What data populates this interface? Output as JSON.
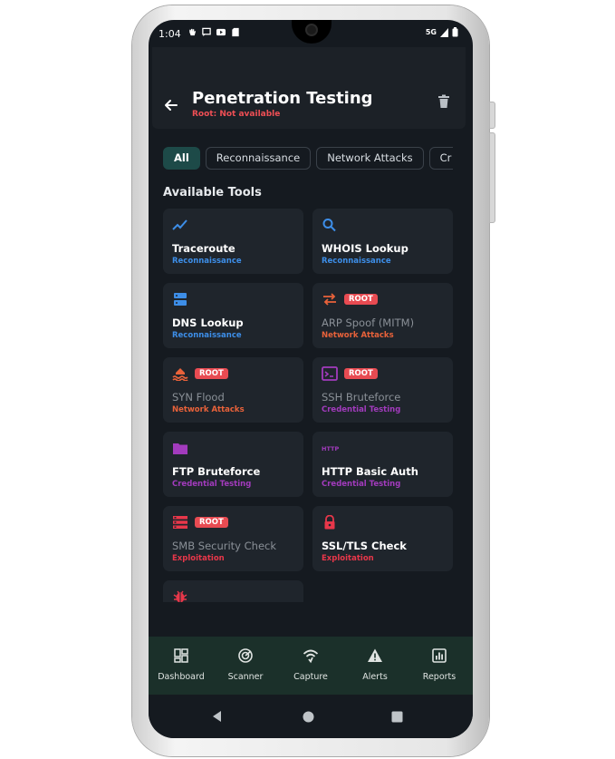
{
  "status_bar": {
    "time": "1:04",
    "network": "5G"
  },
  "app_bar": {
    "title": "Penetration Testing",
    "subtitle": "Root: Not available",
    "back_icon": "arrow-left-icon",
    "delete_icon": "trash-icon"
  },
  "filters": {
    "chips": [
      {
        "label": "All",
        "active": true
      },
      {
        "label": "Reconnaissance",
        "active": false
      },
      {
        "label": "Network Attacks",
        "active": false
      },
      {
        "label": "Cr",
        "active": false
      }
    ]
  },
  "section_title": "Available Tools",
  "root_badge": "ROOT",
  "tools": [
    {
      "name": "Traceroute",
      "category": "Reconnaissance",
      "icon": "trending-line-icon",
      "requires_root": false,
      "enabled": true
    },
    {
      "name": "WHOIS Lookup",
      "category": "Reconnaissance",
      "icon": "search-icon",
      "requires_root": false,
      "enabled": true
    },
    {
      "name": "DNS Lookup",
      "category": "Reconnaissance",
      "icon": "dns-server-icon",
      "requires_root": false,
      "enabled": true
    },
    {
      "name": "ARP Spoof (MITM)",
      "category": "Network Attacks",
      "icon": "swap-arrows-icon",
      "requires_root": true,
      "enabled": false
    },
    {
      "name": "SYN Flood",
      "category": "Network Attacks",
      "icon": "flood-icon",
      "requires_root": true,
      "enabled": false
    },
    {
      "name": "SSH Bruteforce",
      "category": "Credential Testing",
      "icon": "terminal-icon",
      "requires_root": true,
      "enabled": false
    },
    {
      "name": "FTP Bruteforce",
      "category": "Credential Testing",
      "icon": "folder-icon",
      "requires_root": false,
      "enabled": true
    },
    {
      "name": "HTTP Basic Auth",
      "category": "Credential Testing",
      "icon": "http-icon",
      "icon_text": "HTTP",
      "requires_root": false,
      "enabled": true
    },
    {
      "name": "SMB Security Check",
      "category": "Exploitation",
      "icon": "storage-list-icon",
      "requires_root": true,
      "enabled": false
    },
    {
      "name": "SSL/TLS Check",
      "category": "Exploitation",
      "icon": "lock-icon",
      "requires_root": false,
      "enabled": true
    },
    {
      "name": "",
      "category": "",
      "icon": "bug-icon",
      "requires_root": false,
      "enabled": true
    }
  ],
  "bottom_nav": [
    {
      "label": "Dashboard",
      "icon": "dashboard-icon"
    },
    {
      "label": "Scanner",
      "icon": "radar-icon"
    },
    {
      "label": "Capture",
      "icon": "wifi-capture-icon"
    },
    {
      "label": "Alerts",
      "icon": "warning-icon"
    },
    {
      "label": "Reports",
      "icon": "report-chart-icon"
    }
  ],
  "colors": {
    "background": "#151a20",
    "card": "#1f252c",
    "chip_active": "#1d4a48",
    "root_badge": "#e84b52",
    "recon": "#3d8ee8",
    "network_attacks": "#e9623a",
    "credential_testing": "#a23bbd",
    "exploitation": "#e8374a",
    "bottom_nav": "#1b302a"
  }
}
